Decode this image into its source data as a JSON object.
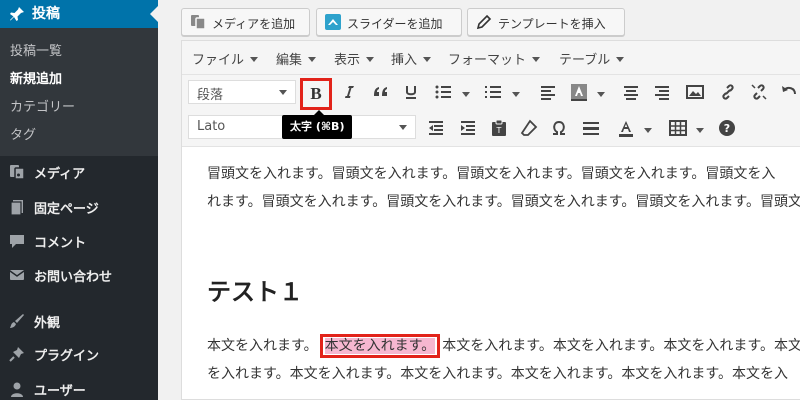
{
  "sidebar": {
    "current_menu": "投稿",
    "submenu": [
      "投稿一覧",
      "新規追加",
      "カテゴリー",
      "タグ"
    ],
    "submenu_active": "新規追加",
    "items": [
      {
        "label": "メディア",
        "icon": "media-icon"
      },
      {
        "label": "固定ページ",
        "icon": "page-icon"
      },
      {
        "label": "コメント",
        "icon": "comment-icon"
      },
      {
        "label": "お問い合わせ",
        "icon": "mail-icon"
      },
      {
        "label": "外観",
        "icon": "brush-icon"
      },
      {
        "label": "プラグイン",
        "icon": "plugin-icon"
      },
      {
        "label": "ユーザー",
        "icon": "user-icon"
      }
    ]
  },
  "top_buttons": {
    "add_media": "メディアを追加",
    "add_slider": "スライダーを追加",
    "insert_template": "テンプレートを挿入"
  },
  "editor": {
    "menubar": [
      "ファイル",
      "編集",
      "表示",
      "挿入",
      "フォーマット",
      "テーブル"
    ],
    "format_select": "段落",
    "font_select": "Lato",
    "tooltip": "太字 (⌘B)",
    "colors": {
      "highlight": "#f6b7d0",
      "callout": "#e2231a",
      "accent": "#0073aa"
    }
  },
  "content": {
    "intro_line1": "冒頭文を入れます。冒頭文を入れます。冒頭文を入れます。冒頭文を入れます。冒頭文を入",
    "intro_line2": "れます。冒頭文を入れます。冒頭文を入れます。冒頭文を入れます。冒頭文を入れます。冒頭文",
    "heading": "テスト１",
    "body_before": "本文を入れます。",
    "body_selected": "本文を入れます。",
    "body_after": "本文を入れます。本文を入れます。本文を入れます。本文",
    "body_line2": "を入れます。本文を入れます。本文を入れます。本文を入れます。本文を入れます。本文を入"
  }
}
